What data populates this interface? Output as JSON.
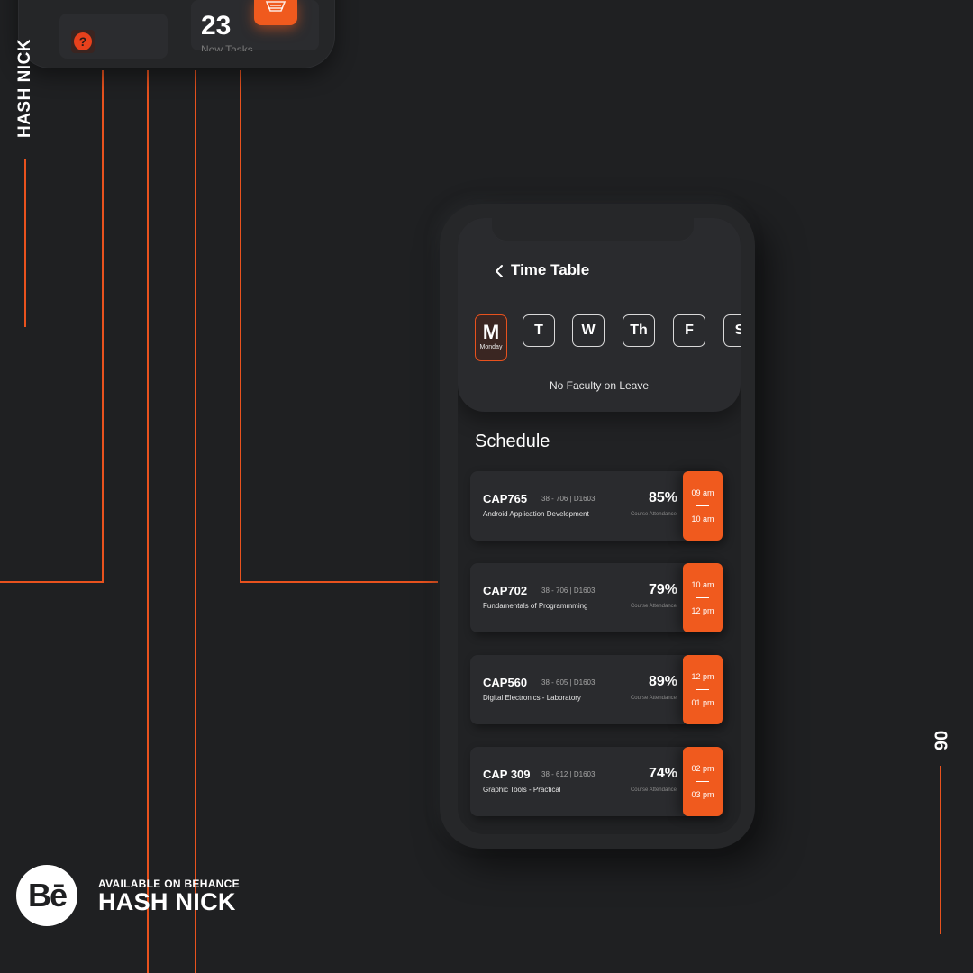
{
  "brand": {
    "side_label": "HASH NICK",
    "page_number": "06",
    "available_text": "AVAILABLE ON BEHANCE",
    "big_name": "HASH NICK",
    "behance_logo_text": "Bē"
  },
  "top_phone": {
    "count": "23",
    "count_label": "New Tasks",
    "help_icon_text": "?"
  },
  "screen": {
    "title": "Time Table",
    "days": [
      {
        "short": "M",
        "full": "Monday",
        "active": true
      },
      {
        "short": "T",
        "active": false
      },
      {
        "short": "W",
        "active": false
      },
      {
        "short": "Th",
        "active": false
      },
      {
        "short": "F",
        "active": false
      },
      {
        "short": "S",
        "active": false
      }
    ],
    "leave_message": "No Faculty on Leave",
    "schedule_title": "Schedule",
    "attendance_label": "Course Attendance",
    "classes": [
      {
        "code": "CAP765",
        "room": "38 - 706  |  D1603",
        "name": "Android Application Development",
        "attendance": "85%",
        "start": "09 am",
        "end": "10 am"
      },
      {
        "code": "CAP702",
        "room": "38 - 706  |  D1603",
        "name": "Fundamentals of Programmming",
        "attendance": "79%",
        "start": "10 am",
        "end": "12 pm"
      },
      {
        "code": "CAP560",
        "room": "38 - 605  |  D1603",
        "name": "Digital Electronics - Laboratory",
        "attendance": "89%",
        "start": "12 pm",
        "end": "01 pm"
      },
      {
        "code": "CAP 309",
        "room": "38 - 612  |  D1603",
        "name": "Graphic Tools - Practical",
        "attendance": "74%",
        "start": "02 pm",
        "end": "03 pm"
      }
    ]
  },
  "colors": {
    "accent": "#f05a1e",
    "background": "#1f2022"
  }
}
